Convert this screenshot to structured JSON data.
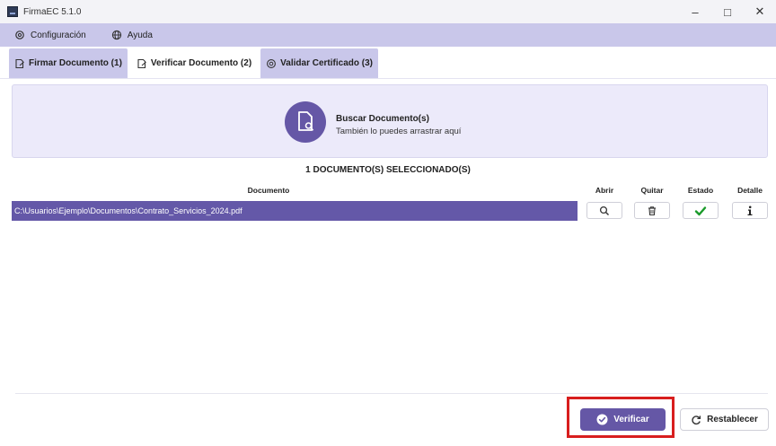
{
  "window": {
    "title": "FirmaEC 5.1.0",
    "minimize": "–",
    "maximize": "□",
    "close": "✕"
  },
  "menu": {
    "items": [
      {
        "label": "Configuración",
        "icon": "gear-icon"
      },
      {
        "label": "Ayuda",
        "icon": "globe-icon"
      }
    ]
  },
  "tabs": [
    {
      "label": "Firmar Documento (1)",
      "icon": "sign-document-icon",
      "active": false
    },
    {
      "label": "Verificar Documento (2)",
      "icon": "sign-document-icon",
      "active": true
    },
    {
      "label": "Validar Certificado (3)",
      "icon": "certificate-icon",
      "active": false
    }
  ],
  "drop_zone": {
    "title": "Buscar Documento(s)",
    "subtitle": "También lo puedes arrastrar aquí"
  },
  "selection": {
    "count_text": "1 DOCUMENTO(S) SELECCIONADO(S)"
  },
  "table": {
    "columns": {
      "document": "Documento",
      "open": "Abrir",
      "remove": "Quitar",
      "status": "Estado",
      "detail": "Detalle"
    },
    "rows": [
      {
        "path": "C:\\Usuarios\\Ejemplo\\Documentos\\Contrato_Servicios_2024.pdf",
        "status": "ok"
      }
    ]
  },
  "actions": {
    "verify_label": "Verificar",
    "reset_label": "Restablecer"
  },
  "colors": {
    "accent": "#6557a6",
    "menubar": "#c9c7ea",
    "status_ok": "#1a9a2a",
    "highlight": "#d81e1e"
  }
}
